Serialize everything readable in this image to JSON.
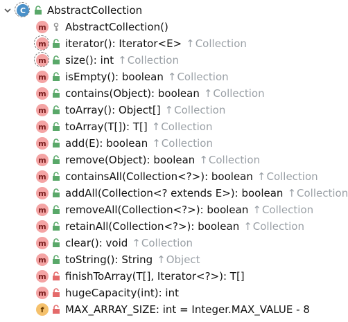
{
  "root": {
    "badge": "C",
    "label": "AbstractCollection"
  },
  "members": [
    {
      "badge": "m",
      "sig": "AbstractCollection()",
      "vis": "protected",
      "inherited": "",
      "abstract": false
    },
    {
      "badge": "m",
      "sig": "iterator(): Iterator<E>",
      "vis": "public",
      "inherited": "Collection",
      "abstract": true
    },
    {
      "badge": "m",
      "sig": "size(): int",
      "vis": "public",
      "inherited": "Collection",
      "abstract": true
    },
    {
      "badge": "m",
      "sig": "isEmpty(): boolean",
      "vis": "public",
      "inherited": "Collection",
      "abstract": false
    },
    {
      "badge": "m",
      "sig": "contains(Object): boolean",
      "vis": "public",
      "inherited": "Collection",
      "abstract": false
    },
    {
      "badge": "m",
      "sig": "toArray(): Object[]",
      "vis": "public",
      "inherited": "Collection",
      "abstract": false
    },
    {
      "badge": "m",
      "sig": "toArray(T[]): T[]",
      "vis": "public",
      "inherited": "Collection",
      "abstract": false
    },
    {
      "badge": "m",
      "sig": "add(E): boolean",
      "vis": "public",
      "inherited": "Collection",
      "abstract": false
    },
    {
      "badge": "m",
      "sig": "remove(Object): boolean",
      "vis": "public",
      "inherited": "Collection",
      "abstract": false
    },
    {
      "badge": "m",
      "sig": "containsAll(Collection<?>): boolean",
      "vis": "public",
      "inherited": "Collection",
      "abstract": false
    },
    {
      "badge": "m",
      "sig": "addAll(Collection<? extends E>): boolean",
      "vis": "public",
      "inherited": "Collection",
      "abstract": false
    },
    {
      "badge": "m",
      "sig": "removeAll(Collection<?>): boolean",
      "vis": "public",
      "inherited": "Collection",
      "abstract": false
    },
    {
      "badge": "m",
      "sig": "retainAll(Collection<?>): boolean",
      "vis": "public",
      "inherited": "Collection",
      "abstract": false
    },
    {
      "badge": "m",
      "sig": "clear(): void",
      "vis": "public",
      "inherited": "Collection",
      "abstract": false
    },
    {
      "badge": "m",
      "sig": "toString(): String",
      "vis": "public",
      "inherited": "Object",
      "abstract": false
    },
    {
      "badge": "m",
      "sig": "finishToArray(T[], Iterator<?>): T[]",
      "vis": "private",
      "inherited": "",
      "abstract": false
    },
    {
      "badge": "m",
      "sig": "hugeCapacity(int): int",
      "vis": "private",
      "inherited": "",
      "abstract": false
    },
    {
      "badge": "f",
      "sig": "MAX_ARRAY_SIZE: int = Integer.MAX_VALUE - 8",
      "vis": "private",
      "inherited": "",
      "abstract": false
    }
  ],
  "inherited_arrow": "↑",
  "colors": {
    "method_badge": "#f4a4a4",
    "field_badge": "#f5c16c",
    "class_badge": "#4a90c8",
    "public_lock": "#59a869",
    "private_lock": "#e46a6a",
    "inherited_text": "#9aa0a6"
  }
}
